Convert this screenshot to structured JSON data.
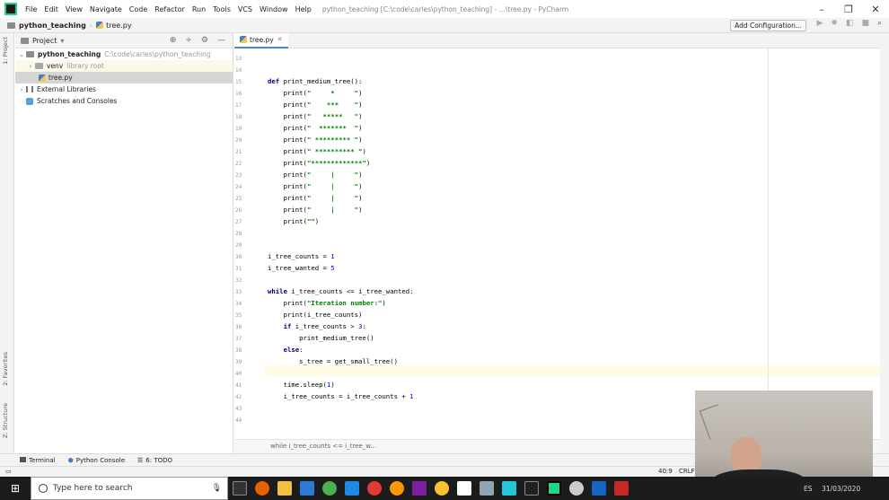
{
  "menubar": {
    "items": [
      "File",
      "Edit",
      "View",
      "Navigate",
      "Code",
      "Refactor",
      "Run",
      "Tools",
      "VCS",
      "Window",
      "Help"
    ],
    "window_title": "python_teaching [C:\\code\\carles\\python_teaching] - ...\\tree.py - PyCharm"
  },
  "navbar": {
    "project": "python_teaching",
    "file": "tree.py",
    "add_config": "Add Configuration..."
  },
  "left_strip": {
    "project_tab": "1: Project",
    "favorites_tab": "2: Favorites",
    "structure_tab": "Z: Structure"
  },
  "project_panel": {
    "title": "Project",
    "tree": [
      {
        "label": "python_teaching",
        "path": "C:\\code\\carles\\python_teaching"
      },
      {
        "label": "venv",
        "note": "library root"
      },
      {
        "label": "tree.py"
      },
      {
        "label": "External Libraries"
      },
      {
        "label": "Scratches and Consoles"
      }
    ]
  },
  "editor": {
    "tab": "tree.py",
    "line_numbers": [
      "13",
      "14",
      "15",
      "16",
      "17",
      "18",
      "19",
      "20",
      "21",
      "22",
      "23",
      "24",
      "25",
      "26",
      "27",
      "28",
      "29",
      "30",
      "31",
      "32",
      "33",
      "34",
      "35",
      "36",
      "37",
      "38",
      "39",
      "40",
      "41",
      "42",
      "43",
      "44"
    ],
    "breadcrumb": "while i_tree_counts <= i_tree_w..."
  },
  "bottom_tools": {
    "terminal": "Terminal",
    "python_console": "Python Console",
    "todo": "6: TODO"
  },
  "statusbar": {
    "position": "40:9",
    "line_sep": "CRLF"
  },
  "taskbar": {
    "search_placeholder": "Type here to search",
    "lang": "ES",
    "date": "31/03/2020"
  }
}
